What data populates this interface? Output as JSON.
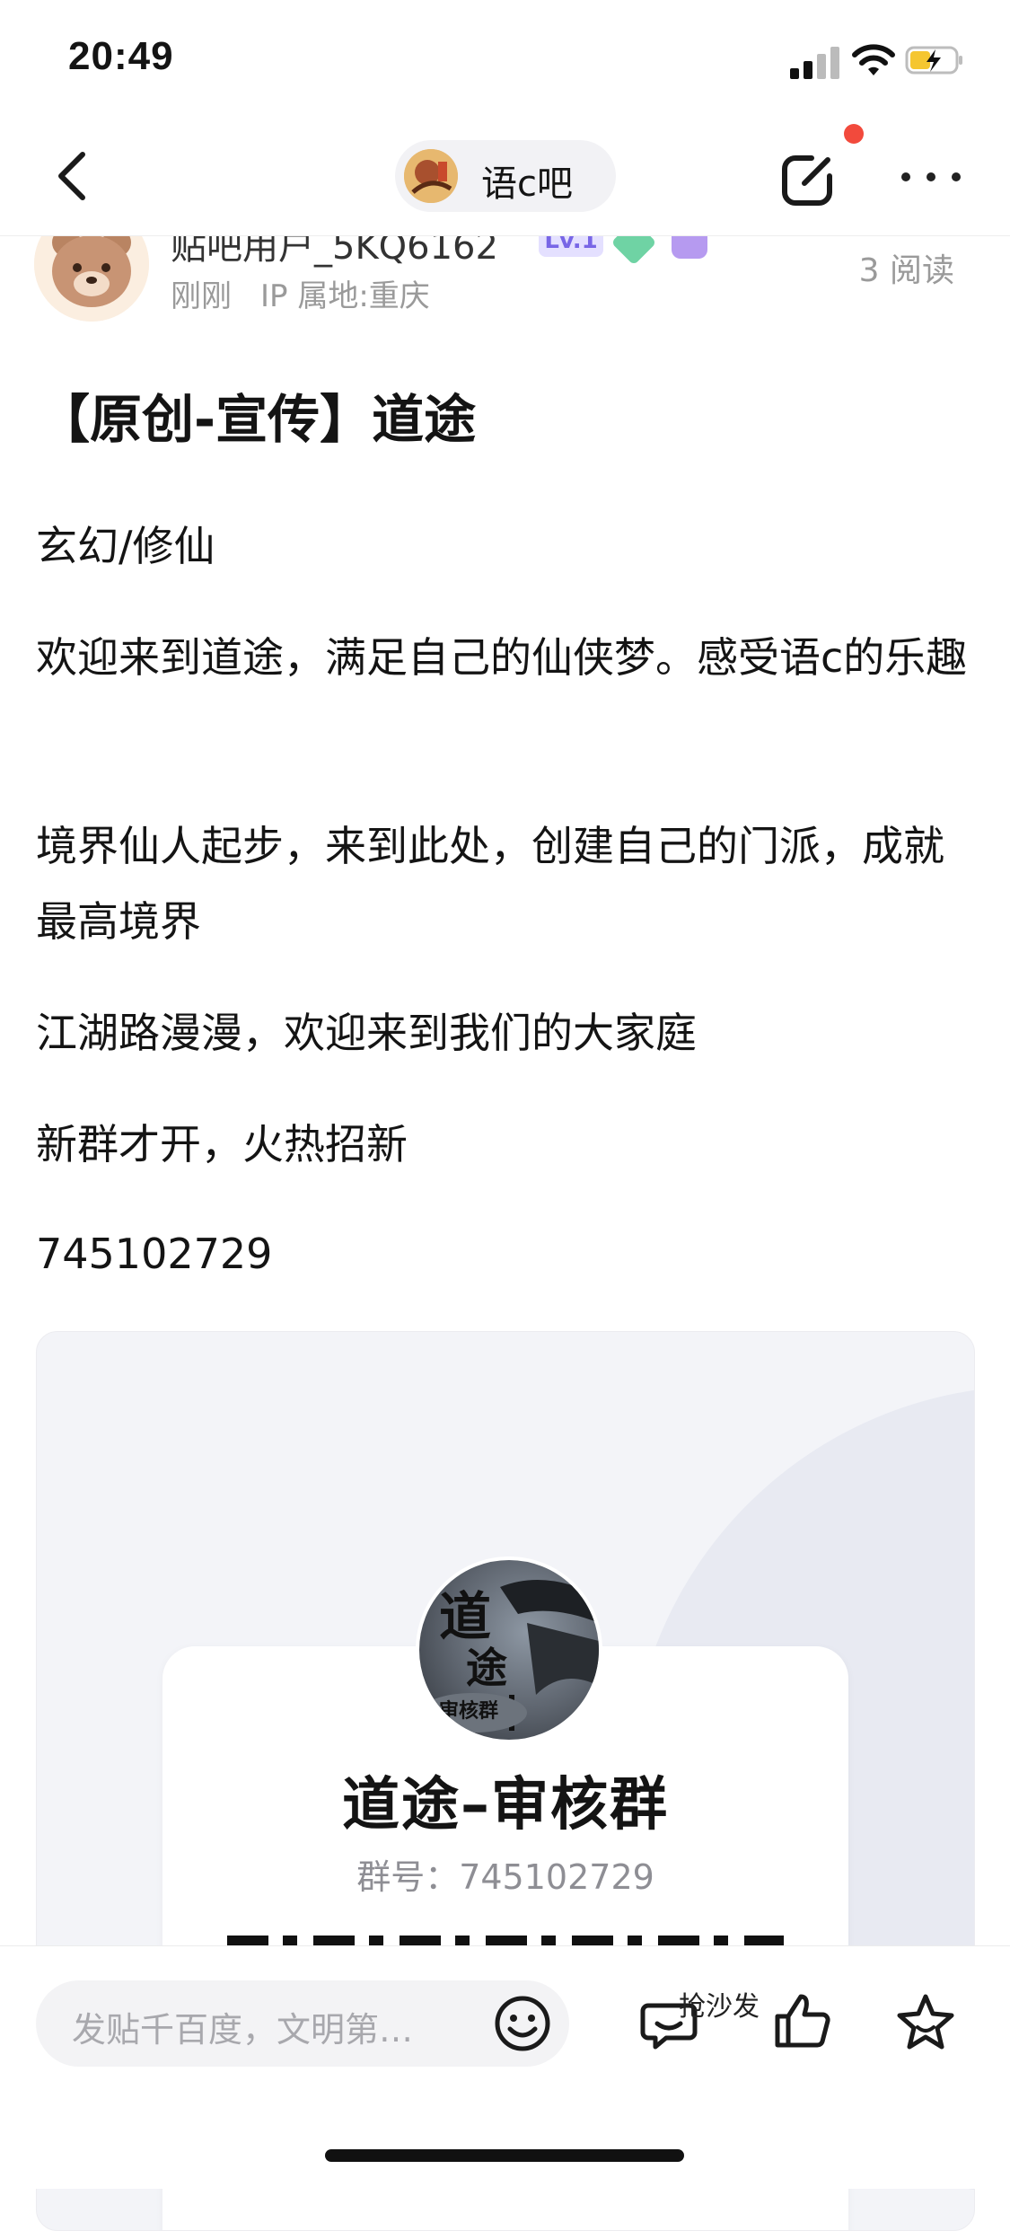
{
  "status_bar": {
    "time": "20:49"
  },
  "nav": {
    "forum_name": "语c吧"
  },
  "post": {
    "username": "贴吧用户_5KQ6162",
    "level": "Lv.1",
    "time": "刚刚",
    "ip_location": "IP 属地:重庆",
    "read_count": "3 阅读",
    "title": "【原创-宣传】道途",
    "paragraphs": [
      "玄幻/修仙",
      "欢迎来到道途，满足自己的仙侠梦。感受语c的乐趣",
      "境界仙人起步，来到此处，创建自己的门派，成就最高境界",
      "江湖路漫漫，欢迎来到我们的大家庭",
      "新群才开，火热招新",
      "745102729"
    ]
  },
  "group_card": {
    "avatar_text": [
      "道",
      "途",
      "审核群"
    ],
    "name": "道途–审核群",
    "id_label": "群号：",
    "id": "745102729"
  },
  "bottom_bar": {
    "comment_placeholder": "发贴千百度，文明第…",
    "sofa_label": "抢沙发"
  }
}
